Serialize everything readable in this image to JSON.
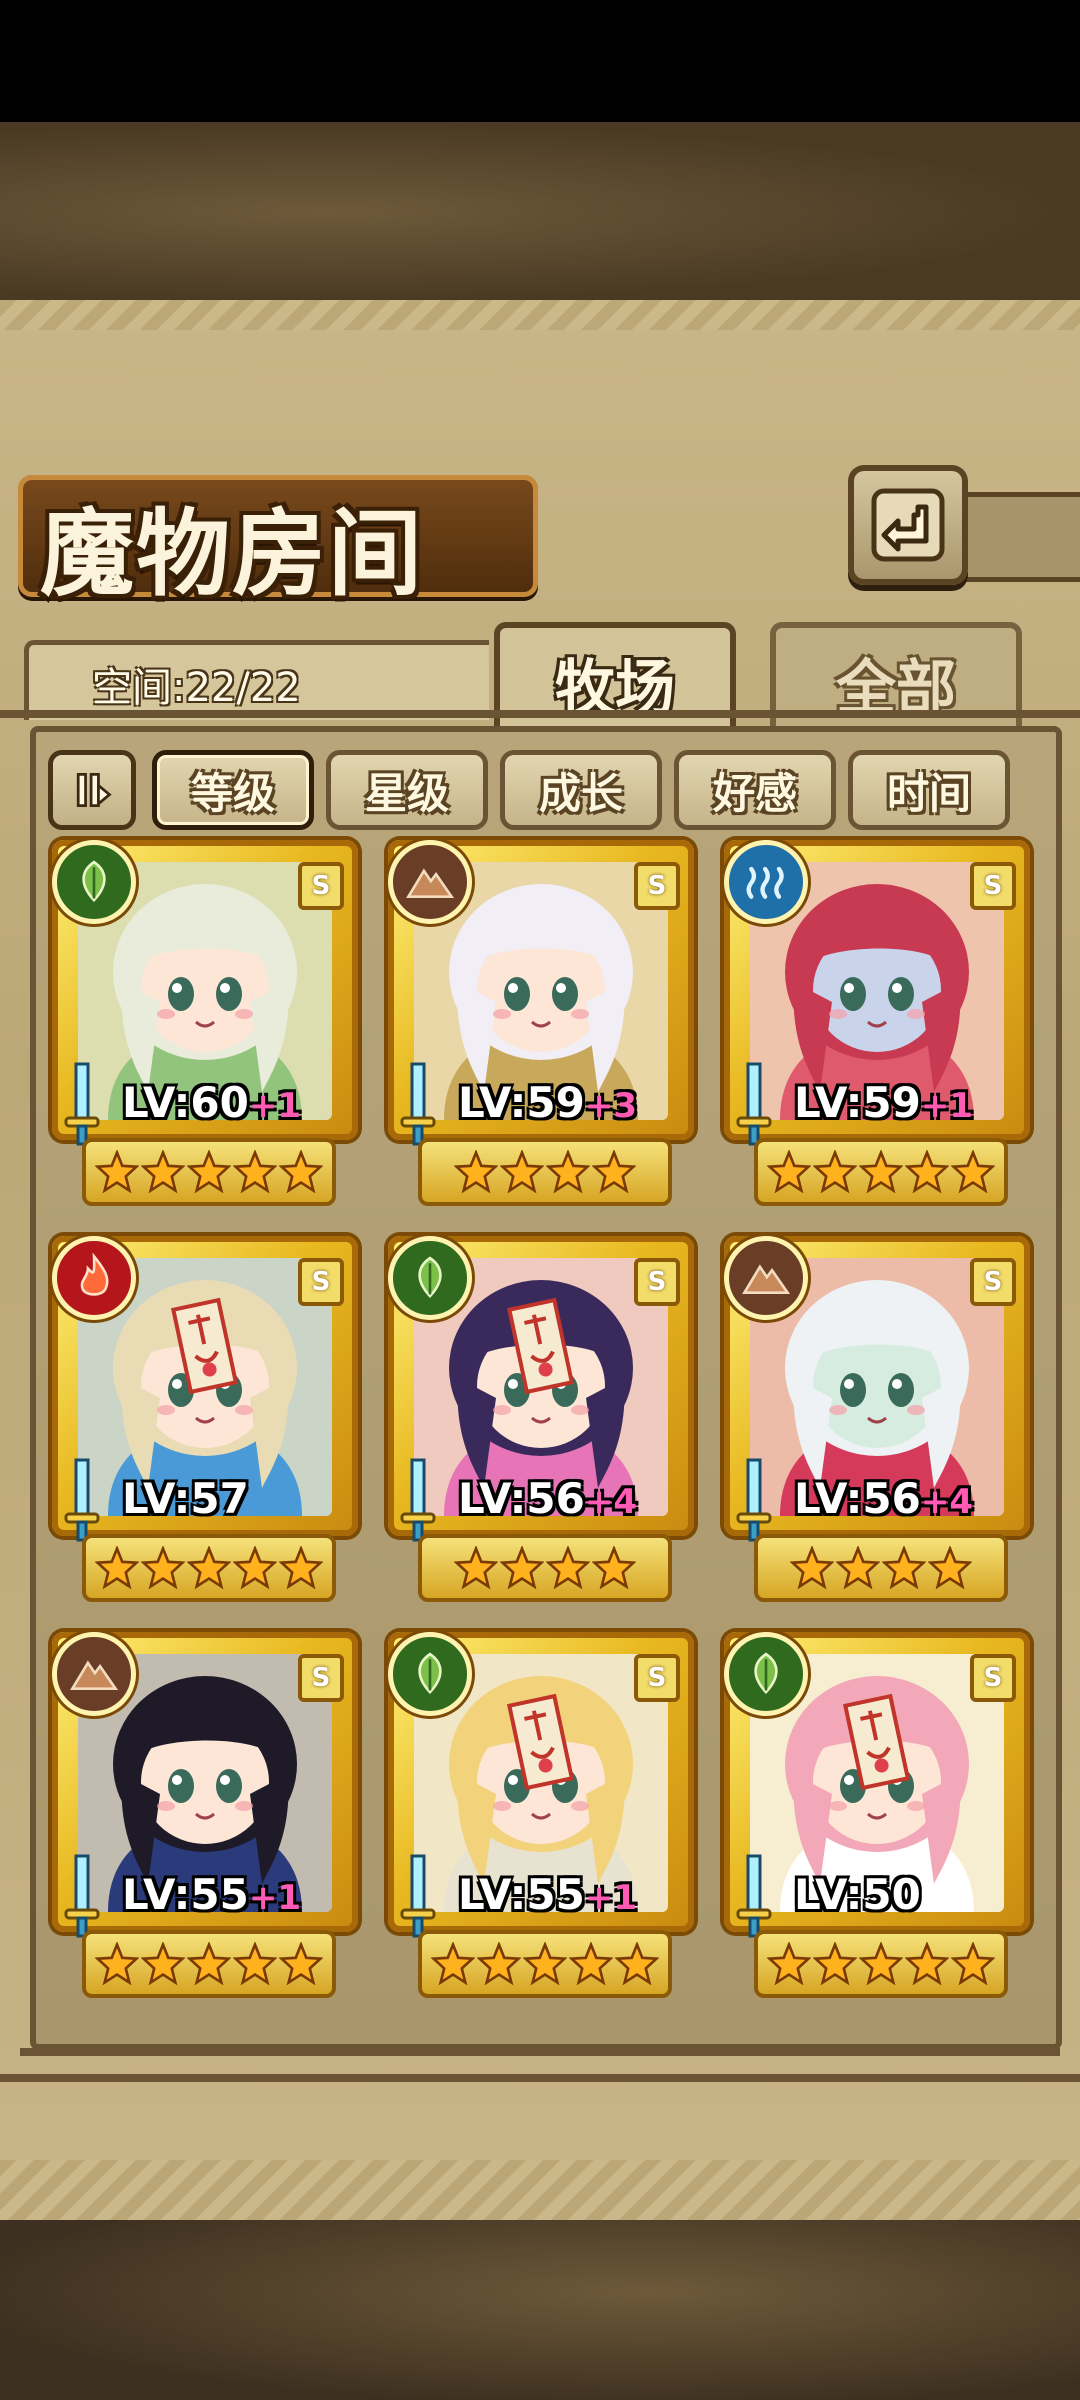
{
  "header": {
    "title": "魔物房间",
    "space_label": "空间:22/22"
  },
  "tabs": [
    {
      "label": "牧场",
      "active": true
    },
    {
      "label": "全部",
      "active": false
    }
  ],
  "sort_buttons": [
    {
      "label": "等级",
      "selected": true
    },
    {
      "label": "星级",
      "selected": false
    },
    {
      "label": "成长",
      "selected": false
    },
    {
      "label": "好感",
      "selected": false
    },
    {
      "label": "时间",
      "selected": false
    }
  ],
  "cards": [
    {
      "element": "leaf",
      "element_color": "#2f6a1e",
      "rank": "S",
      "level": "LV:60",
      "plus": "+1",
      "stars": 5,
      "hair": "#e9ecda",
      "skin": "#fde6d6",
      "accent": "#93c47d",
      "sealed": false
    },
    {
      "element": "mountain",
      "element_color": "#6a3e26",
      "rank": "S",
      "level": "LV:59",
      "plus": "+3",
      "stars": 4,
      "hair": "#f1eef6",
      "skin": "#fde6d6",
      "accent": "#c8a85a",
      "sealed": false
    },
    {
      "element": "water",
      "element_color": "#1f6fa8",
      "rank": "S",
      "level": "LV:59",
      "plus": "+1",
      "stars": 5,
      "hair": "#c73a52",
      "skin": "#c9d4ea",
      "accent": "#e05a6e",
      "sealed": false
    },
    {
      "element": "fire",
      "element_color": "#b4161c",
      "rank": "S",
      "level": "LV:57",
      "plus": "",
      "stars": 5,
      "hair": "#e9dcb4",
      "skin": "#fde6d6",
      "accent": "#4a9ad8",
      "sealed": true
    },
    {
      "element": "leaf",
      "element_color": "#2f6a1e",
      "rank": "S",
      "level": "LV:56",
      "plus": "+4",
      "stars": 4,
      "hair": "#3a2a5c",
      "skin": "#fde6d6",
      "accent": "#e874b8",
      "sealed": true
    },
    {
      "element": "mountain",
      "element_color": "#6a3e26",
      "rank": "S",
      "level": "LV:56",
      "plus": "+4",
      "stars": 4,
      "hair": "#eef2f4",
      "skin": "#d6ece0",
      "accent": "#d63a5a",
      "sealed": false
    },
    {
      "element": "mountain",
      "element_color": "#6a3e26",
      "rank": "S",
      "level": "LV:55",
      "plus": "+1",
      "stars": 5,
      "hair": "#1e1a28",
      "skin": "#fde6d6",
      "accent": "#2a3a7a",
      "sealed": false
    },
    {
      "element": "leaf",
      "element_color": "#2f6a1e",
      "rank": "S",
      "level": "LV:55",
      "plus": "+1",
      "stars": 5,
      "hair": "#f2d27a",
      "skin": "#fde6d6",
      "accent": "#e8e2d0",
      "sealed": true
    },
    {
      "element": "leaf",
      "element_color": "#2f6a1e",
      "rank": "S",
      "level": "LV:50",
      "plus": "",
      "stars": 5,
      "hair": "#f2a8b8",
      "skin": "#fde6d6",
      "accent": "#ffffff",
      "sealed": true
    }
  ]
}
